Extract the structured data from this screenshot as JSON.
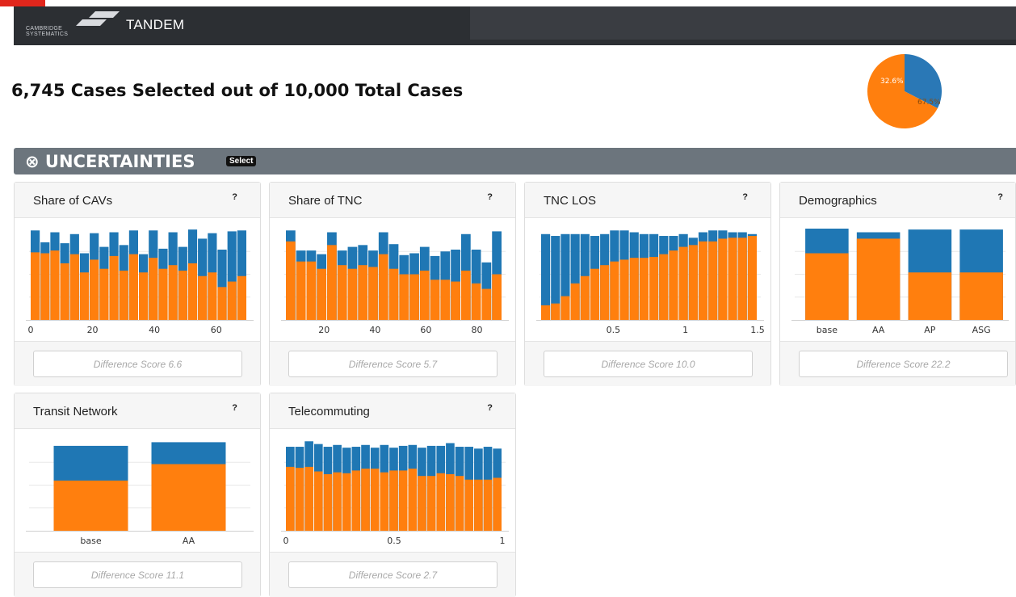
{
  "header": {
    "logo_text": "CAMBRIDGE SYSTEMATICS",
    "app_name": "TANDEM"
  },
  "summary": {
    "headline": "6,745 Cases Selected out of 10,000 Total Cases",
    "pie": {
      "slices": [
        {
          "label": "32.6%",
          "value": 32.6,
          "color": "#2a78b6"
        },
        {
          "label": "67.5%",
          "value": 67.5,
          "color": "#ff7f0e"
        }
      ]
    }
  },
  "section": {
    "title": "⊗ UNCERTAINTIES",
    "select_label": "Select"
  },
  "colors": {
    "selected": "#ff7f0e",
    "unselected": "#1f77b4"
  },
  "panels": [
    {
      "title": "Share of CAVs",
      "help": "?",
      "score": "Difference Score 6.6",
      "chart_data": {
        "type": "bar",
        "x_ticks": [
          {
            "v": 0,
            "label": "0"
          },
          {
            "v": 20,
            "label": "20"
          },
          {
            "v": 40,
            "label": "40"
          },
          {
            "v": 60,
            "label": "60"
          }
        ],
        "x_range": [
          0,
          70
        ],
        "y_range": [
          0,
          1
        ],
        "bins_total": [
          0.98,
          0.85,
          0.96,
          0.84,
          0.94,
          0.73,
          0.95,
          0.8,
          0.96,
          0.82,
          0.98,
          0.72,
          0.98,
          0.78,
          0.96,
          0.8,
          0.99,
          0.89,
          0.95,
          0.77,
          0.97,
          0.98
        ],
        "bins_selected": [
          0.74,
          0.73,
          0.76,
          0.62,
          0.72,
          0.52,
          0.66,
          0.56,
          0.7,
          0.54,
          0.72,
          0.52,
          0.68,
          0.56,
          0.6,
          0.54,
          0.62,
          0.48,
          0.52,
          0.36,
          0.42,
          0.48
        ]
      }
    },
    {
      "title": "Share of TNC",
      "help": "?",
      "score": "Difference Score 5.7",
      "chart_data": {
        "type": "bar",
        "x_ticks": [
          {
            "v": 20,
            "label": "20"
          },
          {
            "v": 40,
            "label": "40"
          },
          {
            "v": 60,
            "label": "60"
          },
          {
            "v": 80,
            "label": "80"
          }
        ],
        "x_range": [
          5,
          90
        ],
        "y_range": [
          0,
          1
        ],
        "bins_total": [
          0.98,
          0.76,
          0.76,
          0.72,
          0.96,
          0.76,
          0.8,
          0.82,
          0.76,
          0.96,
          0.83,
          0.71,
          0.73,
          0.8,
          0.7,
          0.75,
          0.77,
          0.94,
          0.77,
          0.63,
          0.97
        ],
        "bins_selected": [
          0.86,
          0.64,
          0.64,
          0.56,
          0.82,
          0.6,
          0.56,
          0.6,
          0.58,
          0.72,
          0.56,
          0.5,
          0.5,
          0.54,
          0.44,
          0.44,
          0.42,
          0.54,
          0.4,
          0.34,
          0.5
        ]
      }
    },
    {
      "title": "TNC LOS",
      "help": "?",
      "score": "Difference Score 10.0",
      "chart_data": {
        "type": "bar",
        "x_ticks": [
          {
            "v": 0.5,
            "label": "0.5"
          },
          {
            "v": 1,
            "label": "1"
          },
          {
            "v": 1.5,
            "label": "1.5"
          }
        ],
        "x_range": [
          0,
          1.5
        ],
        "y_range": [
          0,
          1
        ],
        "bins_total": [
          0.94,
          0.92,
          0.94,
          0.94,
          0.94,
          0.92,
          0.94,
          0.98,
          0.98,
          0.96,
          0.94,
          0.94,
          0.92,
          0.92,
          0.94,
          0.9,
          0.96,
          0.98,
          0.98,
          0.96,
          0.96,
          0.94
        ],
        "bins_selected": [
          0.16,
          0.18,
          0.26,
          0.4,
          0.48,
          0.56,
          0.6,
          0.64,
          0.66,
          0.68,
          0.68,
          0.69,
          0.72,
          0.76,
          0.8,
          0.82,
          0.86,
          0.86,
          0.89,
          0.9,
          0.9,
          0.92
        ]
      }
    },
    {
      "title": "Demographics",
      "help": "?",
      "score": "Difference Score 22.2",
      "chart_data": {
        "type": "bar",
        "categories": [
          "base",
          "AA",
          "AP",
          "ASG"
        ],
        "y_range": [
          0,
          1
        ],
        "total": [
          1.0,
          0.96,
          0.99,
          0.99
        ],
        "selected": [
          0.73,
          0.89,
          0.52,
          0.52
        ]
      }
    },
    {
      "title": "Transit Network",
      "help": "?",
      "score": "Difference Score 11.1",
      "chart_data": {
        "type": "bar",
        "categories": [
          "base",
          "AA"
        ],
        "y_range": [
          0,
          1
        ],
        "total": [
          0.93,
          0.97
        ],
        "selected": [
          0.55,
          0.73
        ]
      }
    },
    {
      "title": "Telecommuting",
      "help": "?",
      "score": "Difference Score 2.7",
      "chart_data": {
        "type": "bar",
        "x_ticks": [
          {
            "v": 0,
            "label": "0"
          },
          {
            "v": 0.5,
            "label": "0.5"
          },
          {
            "v": 1,
            "label": "1"
          }
        ],
        "x_range": [
          0,
          1
        ],
        "y_range": [
          0,
          1
        ],
        "bins_total": [
          0.92,
          0.92,
          0.98,
          0.95,
          0.92,
          0.94,
          0.91,
          0.92,
          0.94,
          0.91,
          0.94,
          0.91,
          0.93,
          0.94,
          0.91,
          0.93,
          0.93,
          0.96,
          0.92,
          0.92,
          0.9,
          0.92,
          0.9
        ],
        "bins_selected": [
          0.7,
          0.69,
          0.7,
          0.65,
          0.62,
          0.64,
          0.63,
          0.66,
          0.68,
          0.68,
          0.64,
          0.66,
          0.66,
          0.68,
          0.6,
          0.6,
          0.63,
          0.62,
          0.6,
          0.56,
          0.56,
          0.56,
          0.58
        ]
      }
    }
  ]
}
